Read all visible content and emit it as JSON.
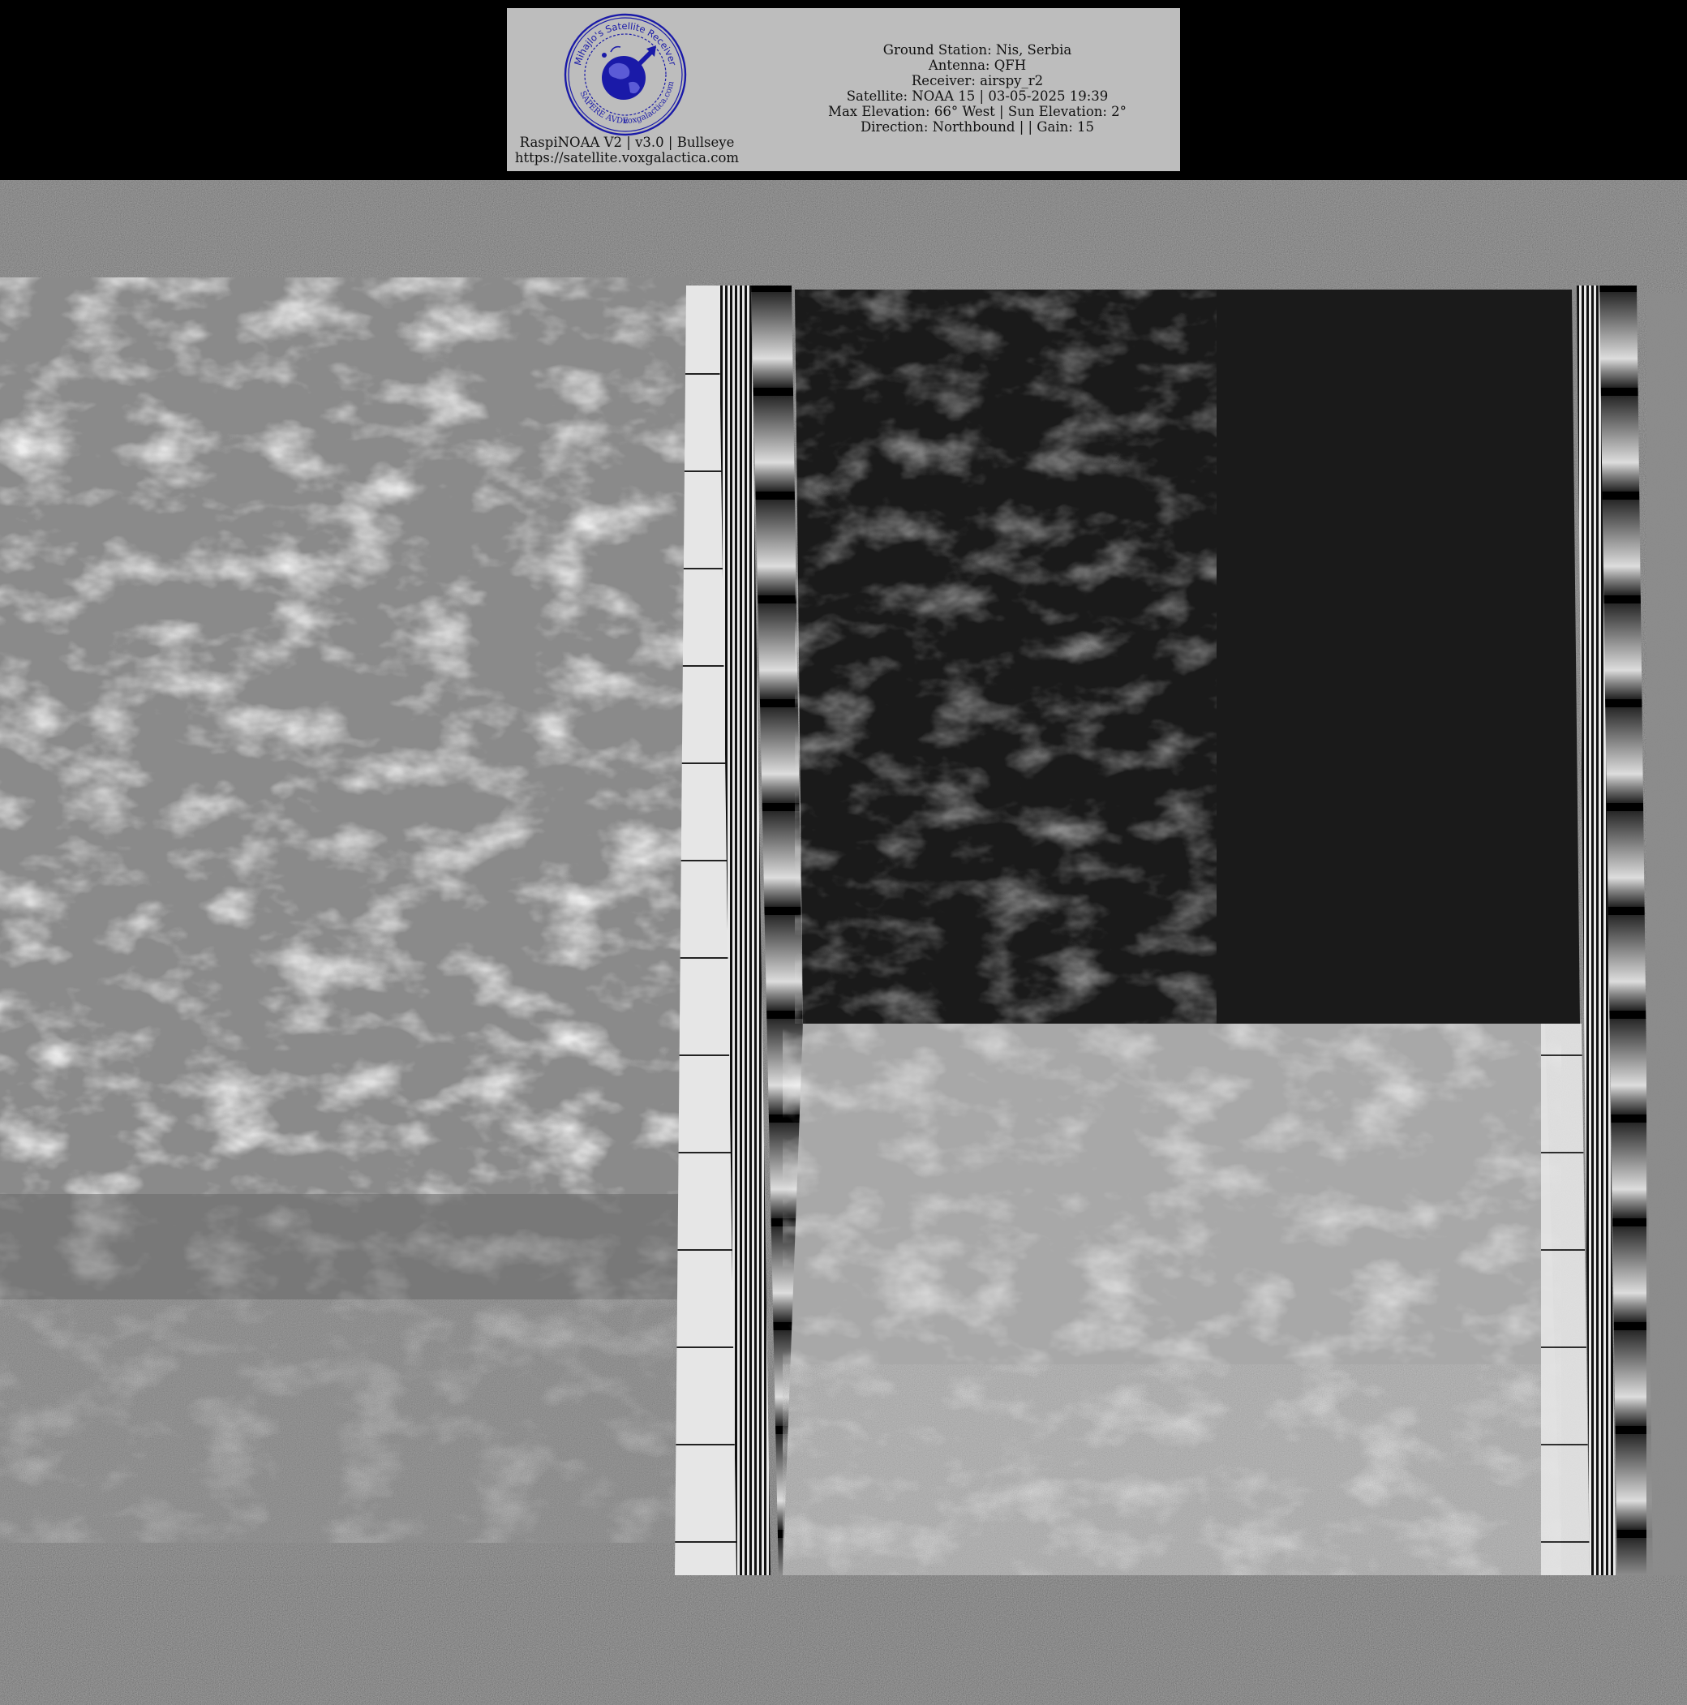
{
  "header": {
    "seal": {
      "top_text": "Mihajlo's Satellite Receiver",
      "motto": "SAPERE AVDE",
      "site": "voxgalactica.com",
      "ink_color": "#1a1aa8"
    },
    "station": {
      "ground_station": "Ground Station: Nis, Serbia",
      "antenna": "Antenna: QFH",
      "receiver": "Receiver: airspy_r2",
      "satellite": "Satellite: NOAA 15 | 03-05-2025 19:39",
      "elevation": "Max Elevation: 66° West | Sun Elevation: 2°",
      "direction": "Direction: Northbound | | Gain: 15"
    },
    "software": {
      "version": "RaspiNOAA V2 | v3.0 | Bullseye",
      "url": "https://satellite.voxgalactica.com"
    }
  },
  "image": {
    "type": "NOAA APT weather satellite image",
    "channels": [
      "thermal infrared (left)",
      "visible / night (right)"
    ],
    "panel_color": "#bdbdbd"
  }
}
